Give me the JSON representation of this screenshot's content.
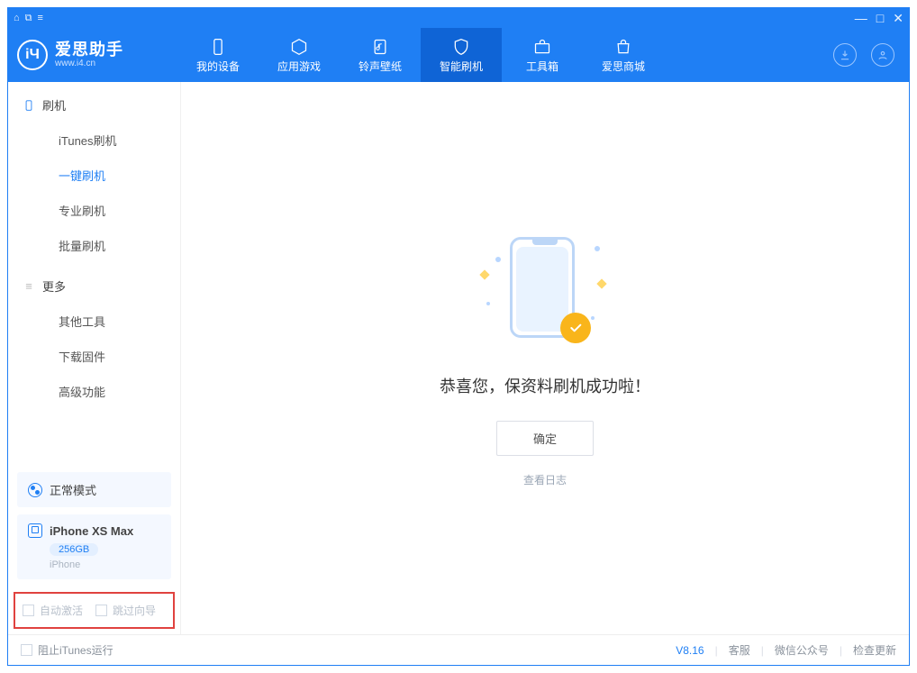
{
  "brand": {
    "title": "爱思助手",
    "sub": "www.i4.cn"
  },
  "tabs": [
    {
      "label": "我的设备",
      "icon": "phone-icon"
    },
    {
      "label": "应用游戏",
      "icon": "cube-icon"
    },
    {
      "label": "铃声壁纸",
      "icon": "music-icon"
    },
    {
      "label": "智能刷机",
      "icon": "shield-icon"
    },
    {
      "label": "工具箱",
      "icon": "toolbox-icon"
    },
    {
      "label": "爱思商城",
      "icon": "shop-icon"
    }
  ],
  "sidebar": {
    "group1": "刷机",
    "items1": [
      "iTunes刷机",
      "一键刷机",
      "专业刷机",
      "批量刷机"
    ],
    "active1": 1,
    "group2": "更多",
    "items2": [
      "其他工具",
      "下载固件",
      "高级功能"
    ]
  },
  "mode_label": "正常模式",
  "device": {
    "name": "iPhone XS Max",
    "storage": "256GB",
    "sub": "iPhone"
  },
  "options": {
    "auto_activate": "自动激活",
    "skip_guide": "跳过向导"
  },
  "main": {
    "success_text": "恭喜您，保资料刷机成功啦！",
    "ok_label": "确定",
    "log_link": "查看日志"
  },
  "footer": {
    "block_itunes": "阻止iTunes运行",
    "version": "V8.16",
    "links": [
      "客服",
      "微信公众号",
      "检查更新"
    ]
  }
}
